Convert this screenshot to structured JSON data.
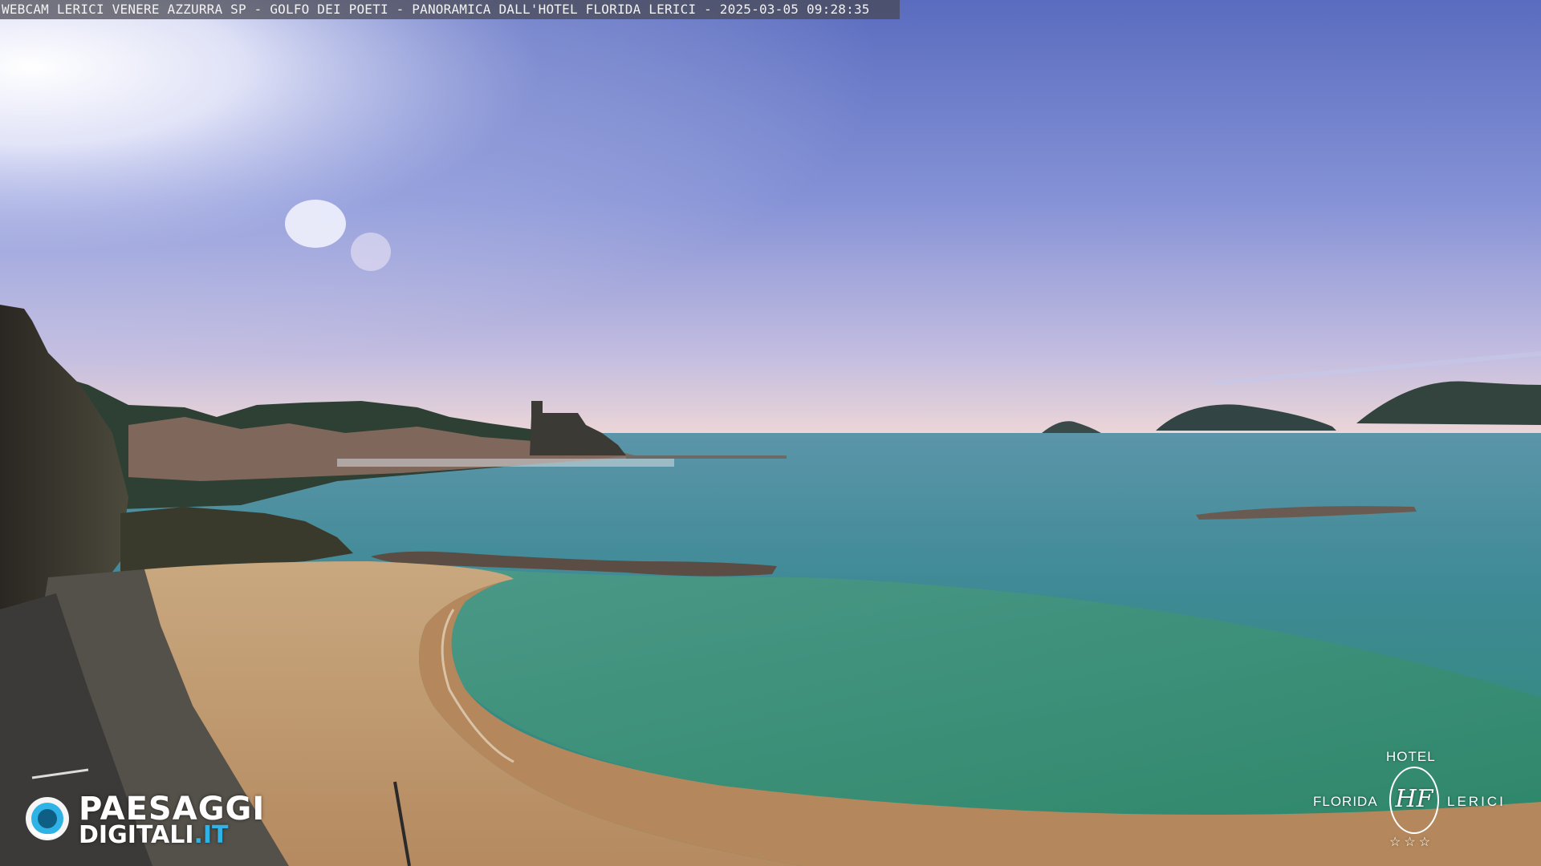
{
  "overlay": {
    "caption": "WEBCAM LERICI VENERE AZZURRA SP - GOLFO DEI POETI - PANORAMICA DALL'HOTEL FLORIDA LERICI - 2025-03-05 09:28:35"
  },
  "branding_left": {
    "line1": "PAESAGGI",
    "line2_main": "DIGITALI",
    "line2_suffix": ".IT",
    "icon": "camera-lens-icon",
    "accent": "#2fb3e6"
  },
  "branding_right": {
    "top": "HOTEL",
    "left": "FLORIDA",
    "right": "LERICI",
    "monogram": "HF",
    "stars": "☆☆☆"
  },
  "colors": {
    "sky_top": "#5d6fc0",
    "sea": "#2f8a8c",
    "sand": "#c9a477"
  }
}
